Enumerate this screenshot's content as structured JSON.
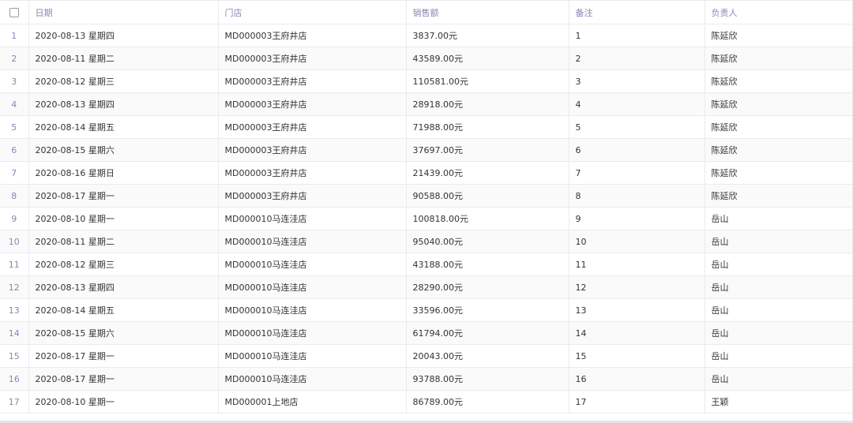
{
  "table": {
    "headers": {
      "date": "日期",
      "store": "门店",
      "sales": "销售额",
      "note": "备注",
      "owner": "负责人"
    },
    "rows": [
      {
        "idx": "1",
        "date": "2020-08-13 星期四",
        "store": "MD000003王府井店",
        "sales": "3837.00元",
        "note": "1",
        "owner": "陈延欣"
      },
      {
        "idx": "2",
        "date": "2020-08-11 星期二",
        "store": "MD000003王府井店",
        "sales": "43589.00元",
        "note": "2",
        "owner": "陈延欣"
      },
      {
        "idx": "3",
        "date": "2020-08-12 星期三",
        "store": "MD000003王府井店",
        "sales": "110581.00元",
        "note": "3",
        "owner": "陈延欣"
      },
      {
        "idx": "4",
        "date": "2020-08-13 星期四",
        "store": "MD000003王府井店",
        "sales": "28918.00元",
        "note": "4",
        "owner": "陈延欣"
      },
      {
        "idx": "5",
        "date": "2020-08-14 星期五",
        "store": "MD000003王府井店",
        "sales": "71988.00元",
        "note": "5",
        "owner": "陈延欣"
      },
      {
        "idx": "6",
        "date": "2020-08-15 星期六",
        "store": "MD000003王府井店",
        "sales": "37697.00元",
        "note": "6",
        "owner": "陈延欣"
      },
      {
        "idx": "7",
        "date": "2020-08-16 星期日",
        "store": "MD000003王府井店",
        "sales": "21439.00元",
        "note": "7",
        "owner": "陈延欣"
      },
      {
        "idx": "8",
        "date": "2020-08-17 星期一",
        "store": "MD000003王府井店",
        "sales": "90588.00元",
        "note": "8",
        "owner": "陈延欣"
      },
      {
        "idx": "9",
        "date": "2020-08-10 星期一",
        "store": "MD000010马连洼店",
        "sales": "100818.00元",
        "note": "9",
        "owner": "岳山"
      },
      {
        "idx": "10",
        "date": "2020-08-11 星期二",
        "store": "MD000010马连洼店",
        "sales": "95040.00元",
        "note": "10",
        "owner": "岳山"
      },
      {
        "idx": "11",
        "date": "2020-08-12 星期三",
        "store": "MD000010马连洼店",
        "sales": "43188.00元",
        "note": "11",
        "owner": "岳山"
      },
      {
        "idx": "12",
        "date": "2020-08-13 星期四",
        "store": "MD000010马连洼店",
        "sales": "28290.00元",
        "note": "12",
        "owner": "岳山"
      },
      {
        "idx": "13",
        "date": "2020-08-14 星期五",
        "store": "MD000010马连洼店",
        "sales": "33596.00元",
        "note": "13",
        "owner": "岳山"
      },
      {
        "idx": "14",
        "date": "2020-08-15 星期六",
        "store": "MD000010马连洼店",
        "sales": "61794.00元",
        "note": "14",
        "owner": "岳山"
      },
      {
        "idx": "15",
        "date": "2020-08-17 星期一",
        "store": "MD000010马连洼店",
        "sales": "20043.00元",
        "note": "15",
        "owner": "岳山"
      },
      {
        "idx": "16",
        "date": "2020-08-17 星期一",
        "store": "MD000010马连洼店",
        "sales": "93788.00元",
        "note": "16",
        "owner": "岳山"
      },
      {
        "idx": "17",
        "date": "2020-08-10 星期一",
        "store": "MD000001上地店",
        "sales": "86789.00元",
        "note": "17",
        "owner": "王颖"
      }
    ]
  }
}
